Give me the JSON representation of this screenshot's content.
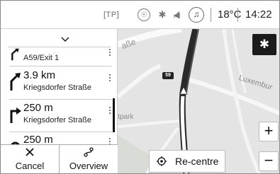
{
  "status_bar": {
    "tp": "[TP]",
    "onstar_icon": "onstar-icon",
    "bluetooth_icon": "bluetooth-icon",
    "mute_icon": "speaker-mute-icon",
    "music_icon": "music-note-icon",
    "temperature": "18°C",
    "time": "14:22"
  },
  "map": {
    "street_label_top": "aße",
    "street_label_right": "Luxembur",
    "park_label": "itpark",
    "road_badge": "59",
    "settings_icon": "gear-icon",
    "zoom_in": "+",
    "zoom_out": "−",
    "recentre_label": "Re-centre",
    "recentre_icon": "target-icon"
  },
  "turn_list": {
    "collapse_icon": "chevron-down-icon",
    "items": [
      {
        "distance": "",
        "street": "A59/Exit 1",
        "arrow": "bear-right-arrow-icon"
      },
      {
        "distance": "3.9 km",
        "street": "Kriegsdorfer Straße",
        "arrow": "bear-right-arrow-icon"
      },
      {
        "distance": "250 m",
        "street": "Kriegsdorfer Straße",
        "arrow": "turn-right-arrow-icon"
      },
      {
        "distance": "250 m",
        "street": "",
        "arrow": "u-turn-arrow-icon"
      }
    ]
  },
  "bottom_bar": {
    "cancel_label": "Cancel",
    "cancel_icon": "close-x-icon",
    "overview_label": "Overview",
    "overview_icon": "route-overview-icon"
  }
}
